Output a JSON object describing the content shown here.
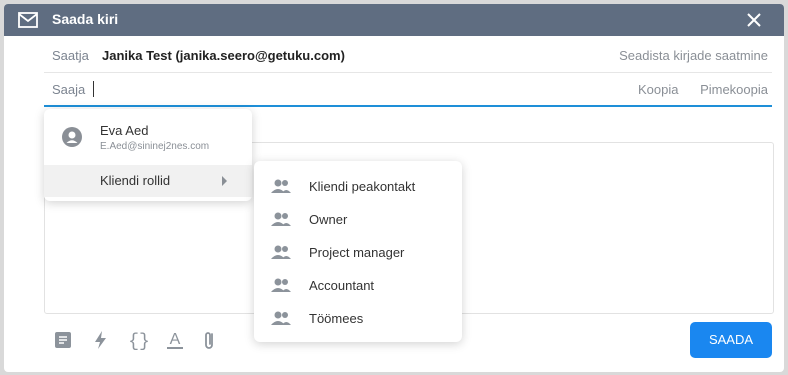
{
  "dialog": {
    "title": "Saada kiri",
    "from_label": "Saatja",
    "from_value": "Janika Test (janika.seero@getuku.com)",
    "from_settings": "Seadista kirjade saatmine",
    "to_label": "Saaja",
    "copy_label": "Koopia",
    "bcc_label": "Pimekoopia",
    "send_label": "SAADA"
  },
  "suggestions": {
    "user_name": "Eva Aed",
    "user_email": "E.Aed@sininej2nes.com",
    "roles_label": "Kliendi rollid"
  },
  "roles": [
    {
      "label": "Kliendi peakontakt"
    },
    {
      "label": "Owner"
    },
    {
      "label": "Project manager"
    },
    {
      "label": "Accountant"
    },
    {
      "label": "Töömees"
    }
  ],
  "toolbar": {
    "icons": [
      "template-icon",
      "flash-icon",
      "braces-icon",
      "text-format-icon",
      "attachment-icon"
    ]
  },
  "colors": {
    "titlebar": "#5f6d81",
    "accent": "#1a87f0"
  }
}
